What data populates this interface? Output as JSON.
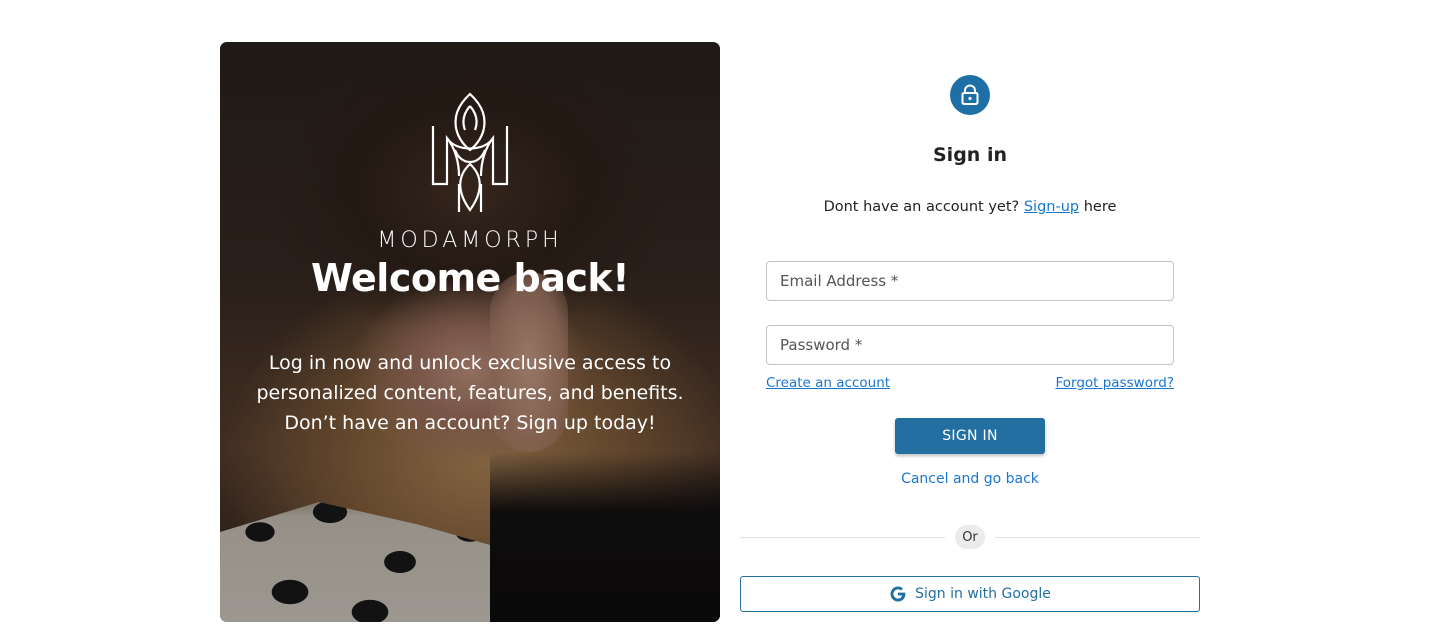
{
  "hero": {
    "brand": "MODAMORPH",
    "headline": "Welcome back!",
    "description": "Log in now and unlock exclusive access to personalized content, features, and benefits. Don’t have an account? Sign up today!"
  },
  "form": {
    "title": "Sign in",
    "signup_prompt_prefix": "Dont have an account yet?",
    "signup_link": "Sign-up",
    "signup_prompt_suffix": "here",
    "email_placeholder": "Email Address *",
    "password_placeholder": "Password *",
    "create_account_link": "Create an account",
    "forgot_password_link": "Forgot password?",
    "sign_in_button": "SIGN IN",
    "cancel_link": "Cancel and go back",
    "divider_text": "Or",
    "google_button": "Sign in with Google"
  },
  "colors": {
    "primary": "#236fa1",
    "link": "#1976d2",
    "lock_badge": "#1d6fa5"
  },
  "icons": {
    "lock": "lock-icon",
    "google": "google-icon",
    "brand_logo": "modamorph-logo-icon"
  }
}
